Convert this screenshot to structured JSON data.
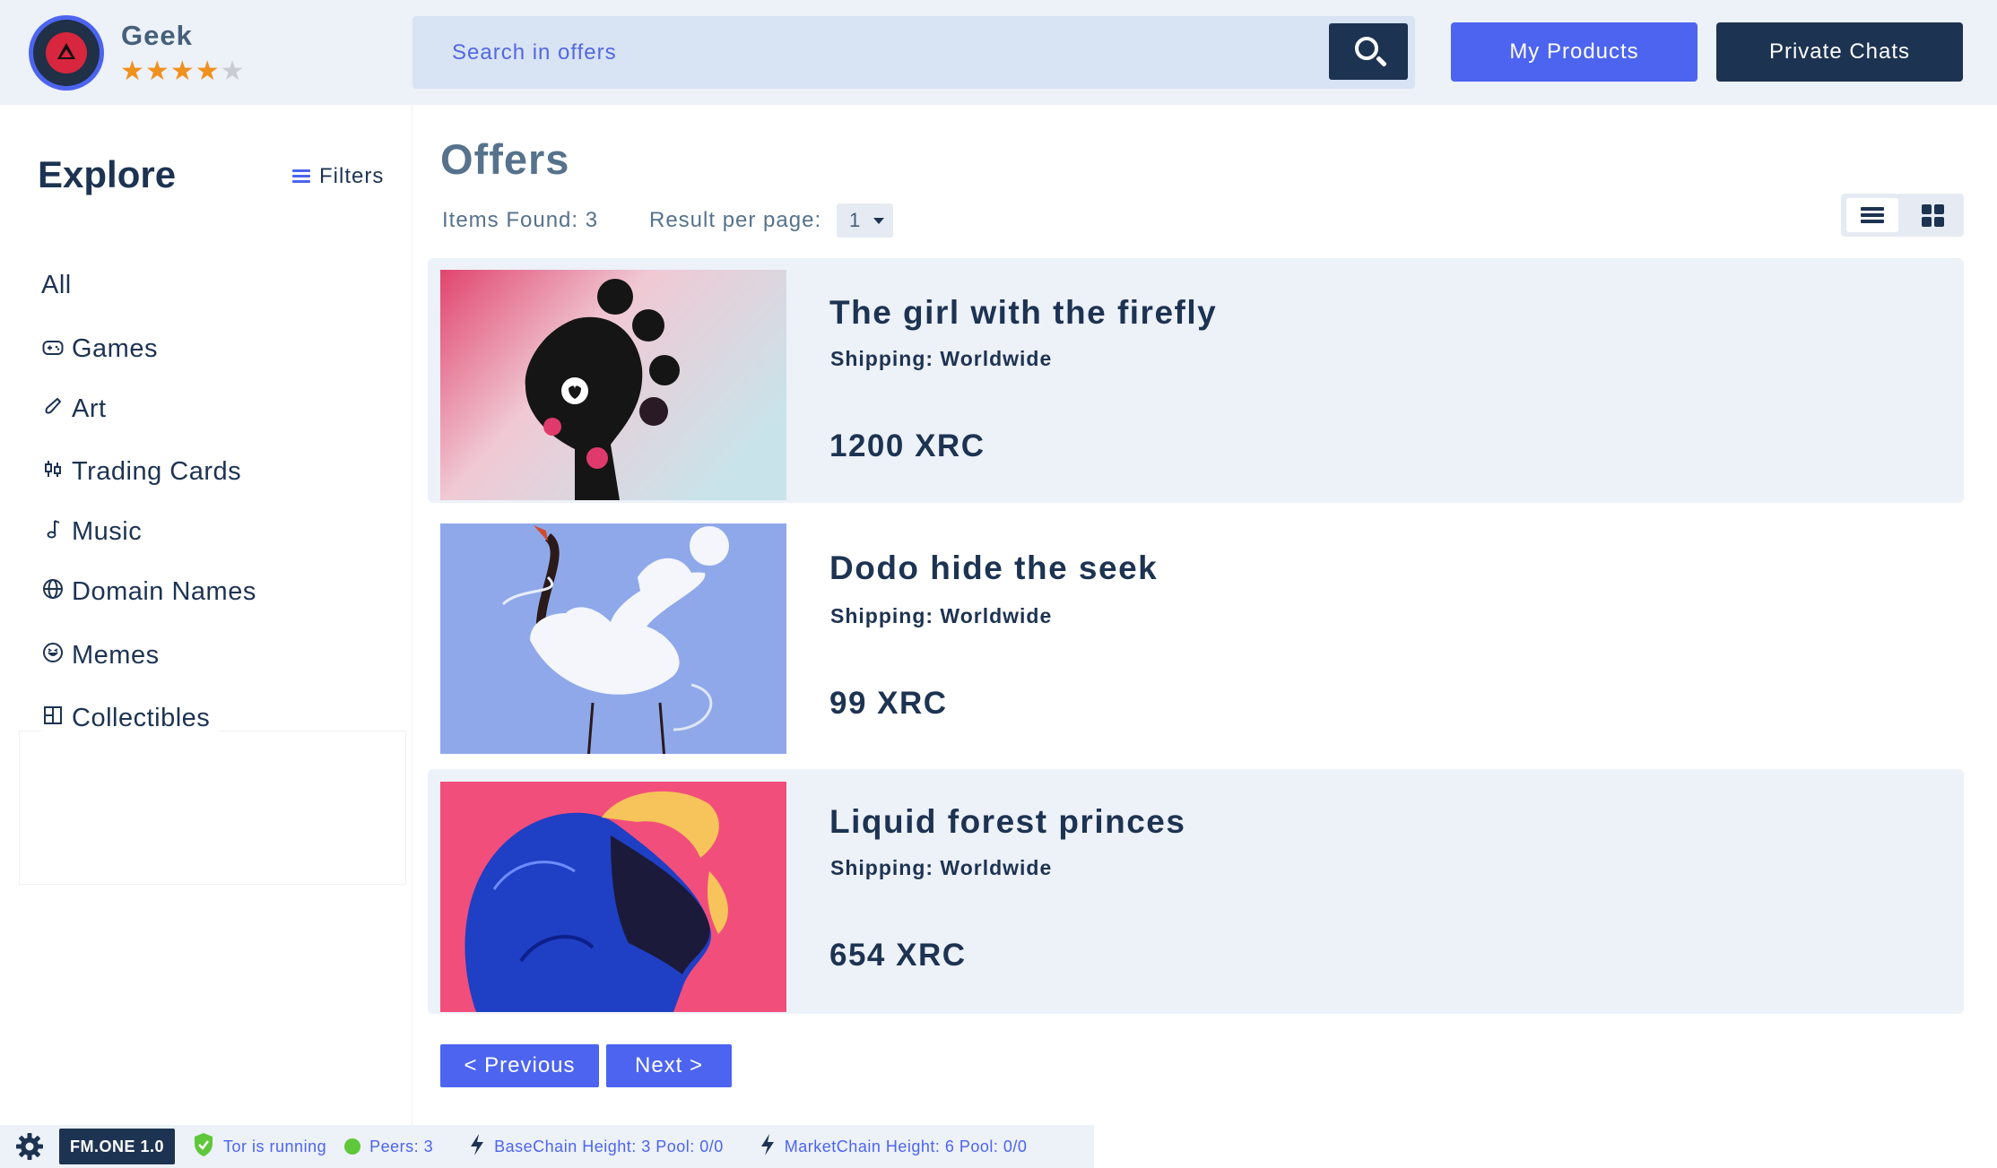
{
  "header": {
    "username": "Geek",
    "rating": 4,
    "rating_max": 5,
    "search_placeholder": "Search in offers",
    "my_products_label": "My Products",
    "private_chats_label": "Private Chats"
  },
  "sidebar": {
    "title": "Explore",
    "filters_label": "Filters",
    "categories": [
      {
        "label": "All",
        "icon": ""
      },
      {
        "label": "Games",
        "icon": "gamepad-icon"
      },
      {
        "label": "Art",
        "icon": "brush-icon"
      },
      {
        "label": "Trading Cards",
        "icon": "candlestick-icon"
      },
      {
        "label": "Music",
        "icon": "music-note-icon"
      },
      {
        "label": "Domain Names",
        "icon": "globe-icon"
      },
      {
        "label": "Memes",
        "icon": "laugh-icon"
      },
      {
        "label": "Collectibles",
        "icon": "grid-box-icon"
      }
    ]
  },
  "main": {
    "title": "Offers",
    "items_found": "Items Found: 3",
    "result_per_page_label": "Result per page:",
    "result_per_page_value": "1",
    "offers": [
      {
        "title": "The girl with the firefly",
        "shipping": "Shipping: Worldwide",
        "price": "1200 XRC"
      },
      {
        "title": "Dodo hide the seek",
        "shipping": "Shipping: Worldwide",
        "price": "99 XRC"
      },
      {
        "title": "Liquid forest princes",
        "shipping": "Shipping: Worldwide",
        "price": "654 XRC"
      }
    ],
    "prev_label": "< Previous",
    "next_label": "Next >"
  },
  "statusbar": {
    "version": "FM.ONE 1.0",
    "tor_status": "Tor is running",
    "peers": "Peers: 3",
    "basechain": "BaseChain Height: 3 Pool: 0/0",
    "marketchain": "MarketChain Height: 6 Pool: 0/0"
  },
  "colors": {
    "accent": "#4c64ef",
    "dark": "#1d3352",
    "panel": "#edf1f8",
    "star": "#f0901d",
    "status_green": "#5fc73a"
  }
}
